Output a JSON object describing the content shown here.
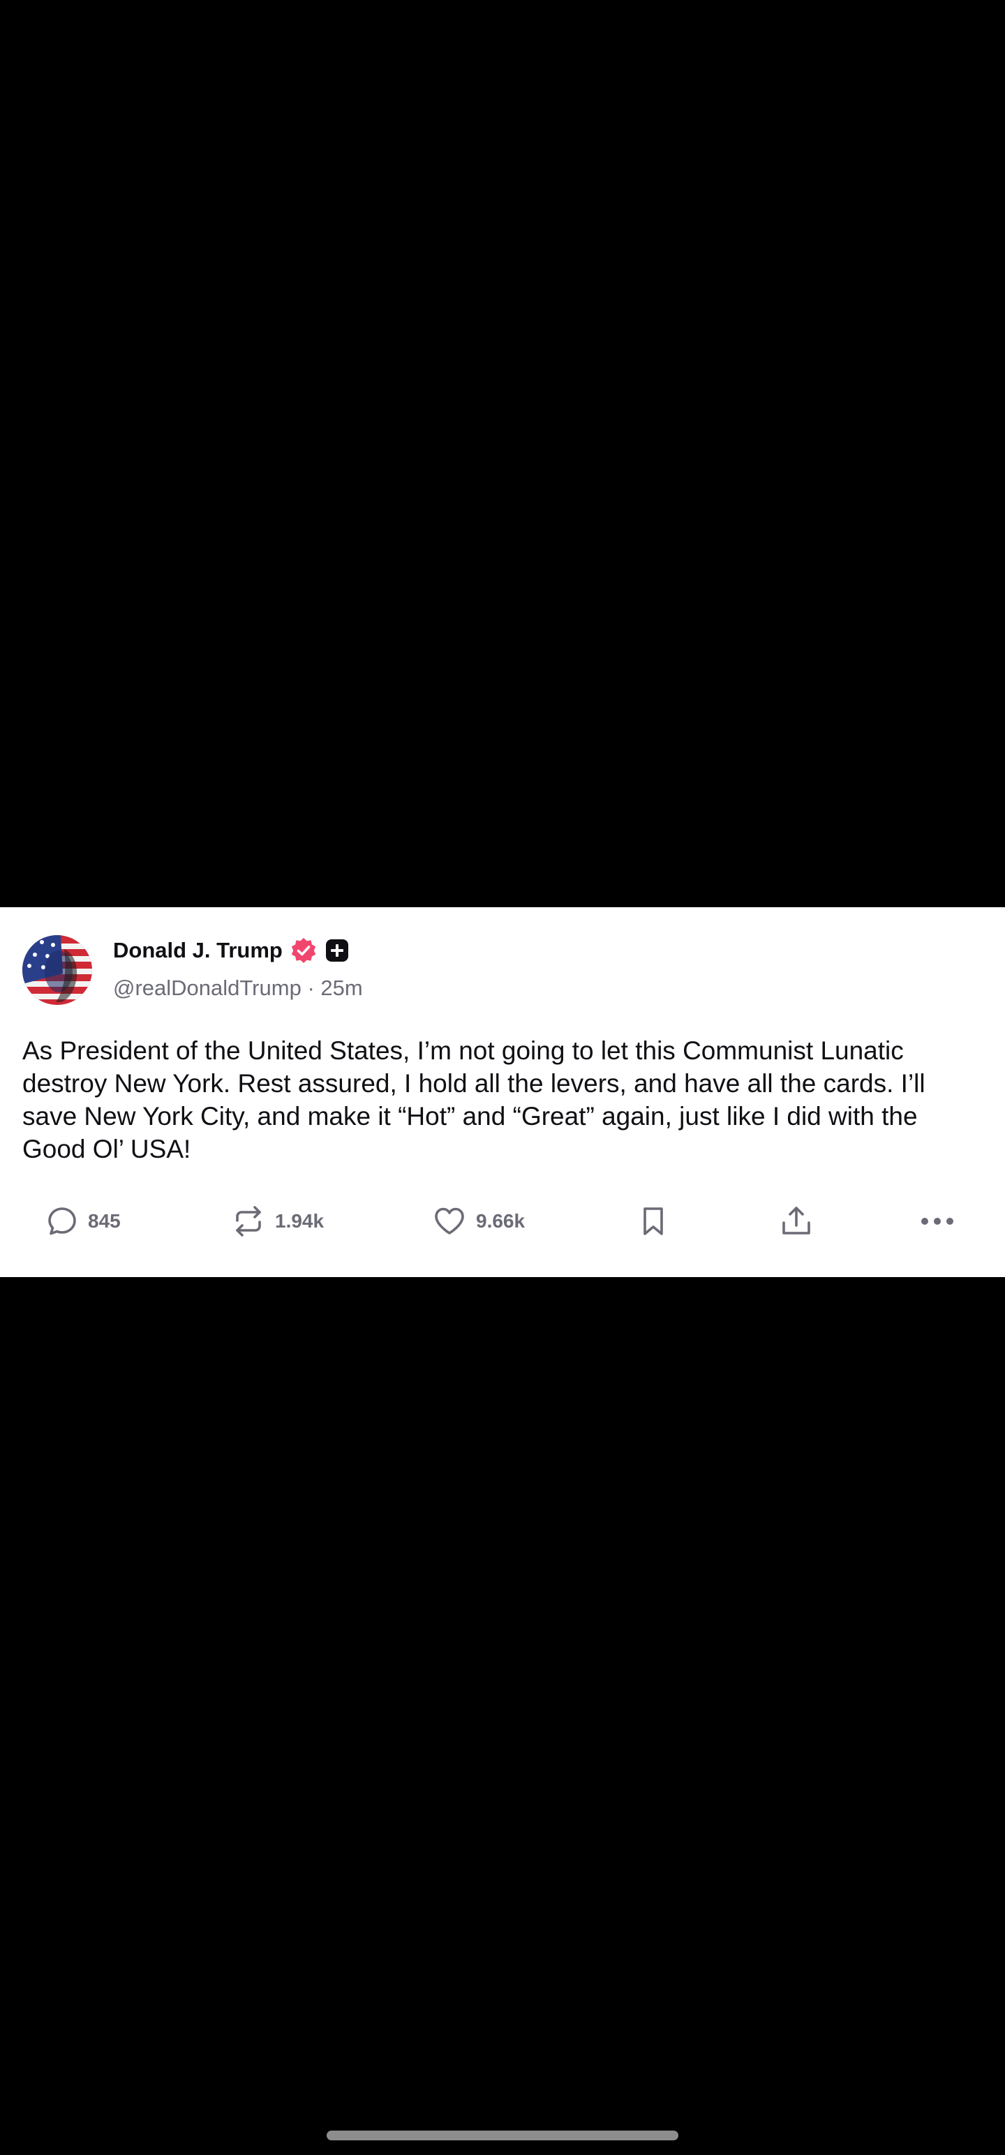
{
  "post": {
    "author_name": "Donald J. Trump",
    "handle": "@realDonaldTrump",
    "separator": "·",
    "time_ago": "25m",
    "text": "As President of the United States, I’m not going to let this Communist Lunatic destroy New York. Rest assured, I hold all the levers, and have all the cards. I’ll save New York City, and make it “Hot” and “Great” again, just like I did with the Good Ol’ USA!",
    "badges": [
      "verified-badge-icon",
      "plus-badge-icon"
    ]
  },
  "actions": {
    "reply_count": "845",
    "repost_count": "1.94k",
    "like_count": "9.66k",
    "icons": [
      "reply-icon",
      "repost-icon",
      "like-icon",
      "bookmark-icon",
      "share-icon",
      "more-icon"
    ]
  },
  "colors": {
    "verified_badge": "#f0466e",
    "text": "#0f0f14",
    "muted": "#6b6b76",
    "background": "#000000",
    "card": "#ffffff"
  }
}
